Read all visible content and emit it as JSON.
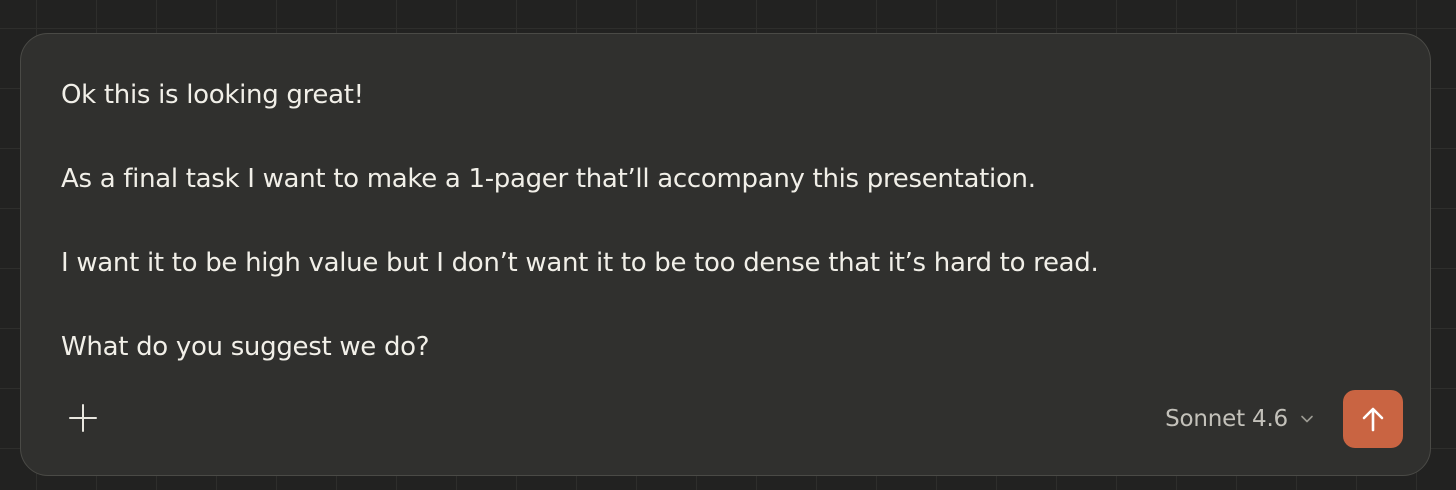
{
  "composer": {
    "message_lines": [
      "Ok this is looking great!",
      "As a final task I want to make a 1-pager that’ll accompany this presentation.",
      "I want it to be high value but I don’t want it to be too dense that it’s hard to read.",
      "What do you suggest we do?"
    ],
    "add_icon": "plus-icon",
    "model_label": "Sonnet 4.6",
    "model_icon": "chevron-down-icon",
    "send_icon": "arrow-up-icon"
  },
  "colors": {
    "background": "#222221",
    "composer_bg": "#30302e",
    "composer_border": "#4a4a46",
    "text": "#f1efe8",
    "muted_text": "#c3c1ba",
    "accent": "#c96442"
  }
}
